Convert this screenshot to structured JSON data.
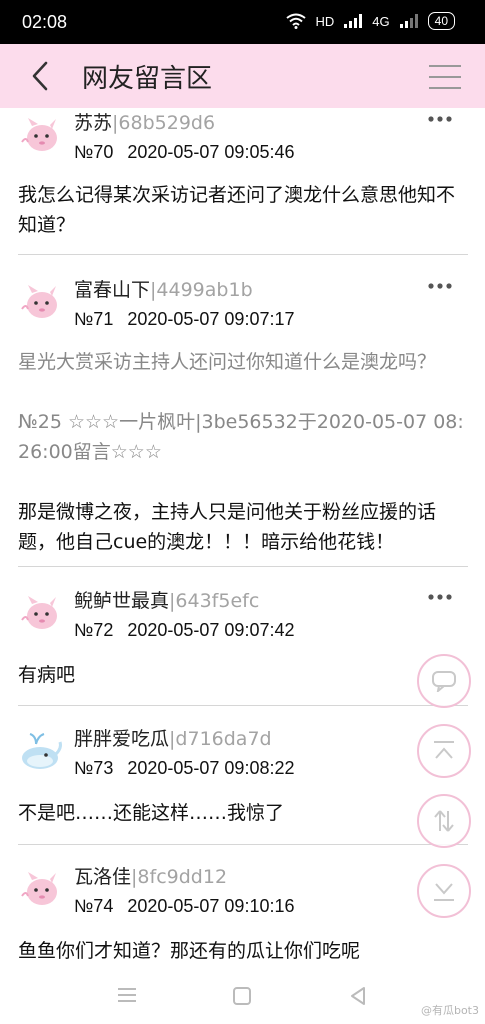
{
  "status_bar": {
    "time": "02:08",
    "network": "HD",
    "signal": "4G",
    "battery": "40"
  },
  "header": {
    "title": "网友留言区"
  },
  "posts": [
    {
      "username": "苏苏",
      "userid": "|68b529d6",
      "number": "№70",
      "datetime": "2020-05-07 09:05:46",
      "content": "我怎么记得某次采访记者还问了澳龙什么意思他知不知道？"
    },
    {
      "username": "富春山下",
      "userid": "|4499ab1b",
      "number": "№71",
      "datetime": "2020-05-07 09:07:17",
      "quote_text": "星光大赏采访主持人还问过你知道什么是澳龙吗？",
      "quote_source": "№25 ☆☆☆一片枫叶|3be56532于2020-05-07 08:26:00留言☆☆☆",
      "content": "那是微博之夜，主持人只是问他关于粉丝应援的话题，他自己cue的澳龙！！！暗示给他花钱！"
    },
    {
      "username": "鲵鲈世最真",
      "userid": "|643f5efc",
      "number": "№72",
      "datetime": "2020-05-07 09:07:42",
      "content": "有病吧"
    },
    {
      "username": "胖胖爱吃瓜",
      "userid": "|d716da7d",
      "number": "№73",
      "datetime": "2020-05-07 09:08:22",
      "content": "不是吧……还能这样……我惊了"
    },
    {
      "username": "瓦洛佳",
      "userid": "|8fc9dd12",
      "number": "№74",
      "datetime": "2020-05-07 09:10:16",
      "content": "鱼鱼你们才知道？那还有的瓜让你们吃呢"
    }
  ],
  "watermark": "@有瓜bot3",
  "colors": {
    "header_bg": "#fcdcec",
    "accent_pink": "#f2c0d6",
    "id_gray": "#a3a3a3"
  }
}
